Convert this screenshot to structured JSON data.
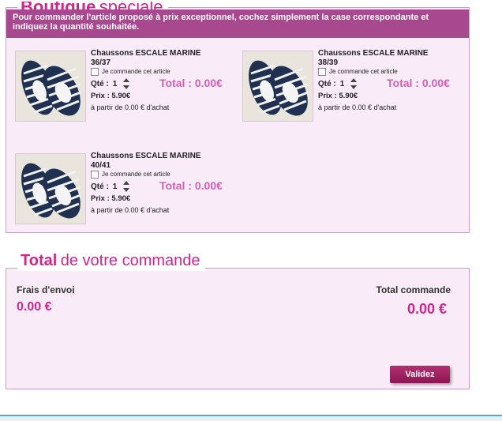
{
  "boutique": {
    "heading_strong": "Boutique",
    "heading_light": "spéciale",
    "banner": "Pour commander l'article proposé à prix exceptionnel, cochez simplement la case correspondante et indiquez la quantité souhaitée.",
    "products": [
      {
        "name": "Chaussons ESCALE MARINE",
        "size": "36/37",
        "check_label": "Je commande cet article",
        "qty_label": "Qté :",
        "qty": "1",
        "total": "Total : 0.00€",
        "price": "Prix : 5.90€",
        "min_order": "à partir de 0.00 € d'achat"
      },
      {
        "name": "Chaussons ESCALE MARINE",
        "size": "38/39",
        "check_label": "Je commande cet article",
        "qty_label": "Qté :",
        "qty": "1",
        "total": "Total : 0.00€",
        "price": "Prix : 5.90€",
        "min_order": "à partir de 0.00 € d'achat"
      },
      {
        "name": "Chaussons ESCALE MARINE",
        "size": "40/41",
        "check_label": "Je commande cet article",
        "qty_label": "Qté :",
        "qty": "1",
        "total": "Total : 0.00€",
        "price": "Prix : 5.90€",
        "min_order": "à partir de 0.00 € d'achat"
      }
    ]
  },
  "order_total": {
    "heading_strong": "Total",
    "heading_light": "de votre commande",
    "shipping_label": "Frais d'envoi",
    "shipping_value": "0.00 €",
    "total_label": "Total commande",
    "total_value": "0.00 €",
    "validate_label": "Validez"
  },
  "colors": {
    "accent": "#d0258c",
    "banner": "#a8488f",
    "panel": "#f9ebf8",
    "button": "#9c1f5f"
  }
}
